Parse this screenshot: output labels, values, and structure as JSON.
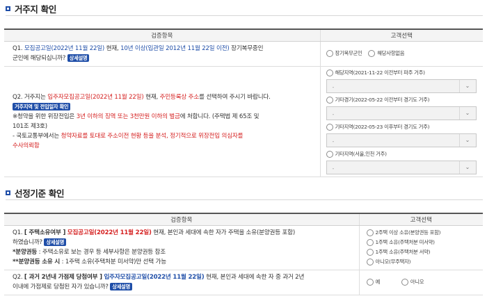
{
  "section1": {
    "title": "거주지 확인",
    "header_q": "검증항목",
    "header_c": "고객선택",
    "q1": {
      "prefix": "Q1.",
      "announce": "모집공고일(2022년 11월 22일)",
      "mid1": "현재,",
      "years": "10년 이상(입관일 2012년 11월 22일 이전)",
      "tail": "장기복무중인",
      "line2": "군인에 해당되십니까?",
      "detail_badge": "상세설명",
      "options": [
        "장기복무군인",
        "해당사항없음"
      ]
    },
    "q2": {
      "prefix": "Q2. 거주지는",
      "announce": "입주자모집공고일(2022년 11월 22일)",
      "mid": "현재,",
      "addr": "주민등록상 주소",
      "tail": "를 선택하여 주시기 바랍니다.",
      "badge": "거주지역 및 전입일자 확인",
      "warn1_prefix": "※청약을 위한 위장전입은",
      "warn1_red": "3년 이하의 징역 또는 3천만원 이하의 벌금",
      "warn1_tail": "에 처합니다. (주택법 제 65조 및",
      "warn1_line2": "101조 제3호)",
      "warn2_prefix": "- 국토교통부에서는",
      "warn2_red": "청약자료를 토대로 주소이전 현황 등을 분석, 정기적으로 위장전입 의심자를",
      "warn2_red2": "수사의뢰함",
      "regions": [
        {
          "label": "해당지역(2021-11-22 이전부터 파주 거주)",
          "select": "-"
        },
        {
          "label": "기타경기(2022-05-22 이전부터 경기도 거주)",
          "select": "-"
        },
        {
          "label": "기타지역(2022-05-23 이후부터 경기도 거주)",
          "select": "-"
        },
        {
          "label": "기타지역(서울,인천 거주)",
          "select": "-"
        }
      ]
    }
  },
  "section2": {
    "title": "선정기준 확인",
    "header_q": "검증항목",
    "header_c": "고객선택",
    "q1": {
      "prefix": "Q1.",
      "bracket": "[ 주택소유여부 ]",
      "announce": "모집공고일(2022년 11월 22일)",
      "tail": "현재, 본인과 세대에 속한 자가 주택을 소유(분양권등 포함)",
      "line2": "하였습니까?",
      "badge": "상세설명",
      "note1_bold": "*분양권등",
      "note1_tail": ": 주택소유로 보는 경우 등 세부사항은 분양권등 참조",
      "note2_bold": "**분양권등 소유 시",
      "note2_tail": ": 1주택 소유(주택처분 미서약)만 선택 가능",
      "options": [
        "2주택 이상 소유(분양권등 포함)",
        "1주택 소유(주택처분 미서약)",
        "1주택 소유(주택처분 서약)",
        "아니오(무주택자)"
      ]
    },
    "q2": {
      "prefix": "Q2.",
      "bracket": "[ 과거 2년내 가점제 당첨여부 ]",
      "announce": "입주자모집공고일(2022년 11월 22일)",
      "tail": "현재, 본인과 세대에 속한 자 중 과거 2년",
      "line2": "이내에 가점제로 당첨된 자가 있습니까?",
      "badge": "상세설명",
      "options": [
        "예",
        "아니오"
      ]
    }
  }
}
